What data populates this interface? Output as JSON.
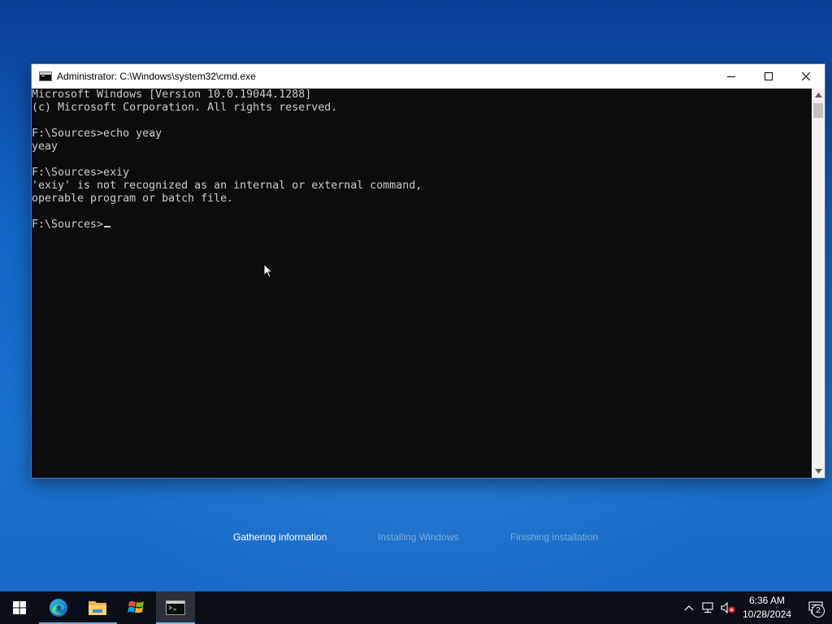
{
  "window": {
    "title": "Administrator: C:\\Windows\\system32\\cmd.exe",
    "icon": "cmd-icon",
    "controls": [
      "minimize-icon",
      "maximize-icon",
      "close-icon"
    ]
  },
  "console": {
    "lines": [
      "Microsoft Windows [Version 10.0.19044.1288]",
      "(c) Microsoft Corporation. All rights reserved.",
      "",
      "F:\\Sources>echo yeay",
      "yeay",
      "",
      "F:\\Sources>exiy",
      "'exiy' is not recognized as an internal or external command,",
      "operable program or batch file.",
      "",
      "F:\\Sources>"
    ],
    "text_color": "#cccccc",
    "background": "#0c0c0c"
  },
  "setup": {
    "steps": [
      {
        "label": "Gathering information",
        "state": "active"
      },
      {
        "label": "Installing Windows",
        "state": "inactive"
      },
      {
        "label": "Finishing installation",
        "state": "inactive"
      }
    ]
  },
  "taskbar": {
    "items": [
      {
        "name": "start-button",
        "icon": "windows-logo-icon"
      },
      {
        "name": "edge",
        "icon": "edge-icon"
      },
      {
        "name": "file-explorer",
        "icon": "folder-icon"
      },
      {
        "name": "windows-setup",
        "icon": "windows-flag-icon"
      },
      {
        "name": "command-prompt",
        "icon": "cmd-icon"
      }
    ],
    "tray": {
      "icons": [
        "chevron-up-icon",
        "network-icon",
        "volume-muted-icon"
      ],
      "time": "6:36 AM",
      "date": "10/28/2024",
      "notification_count": "2"
    }
  },
  "colors": {
    "accent": "#76b9ed",
    "taskbar": "#0a0e17",
    "desktop": "#1265c4"
  }
}
